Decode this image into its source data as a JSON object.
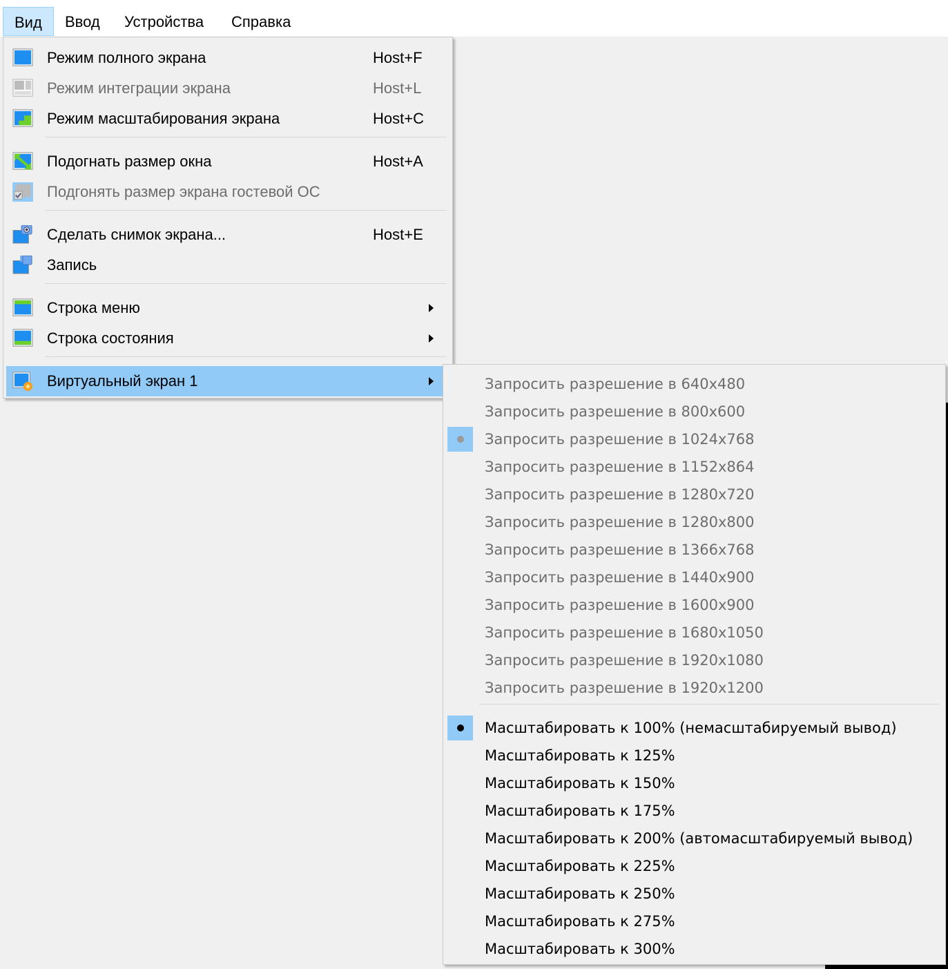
{
  "menubar": [
    "Вид",
    "Ввод",
    "Устройства",
    "Справка"
  ],
  "view_menu": {
    "items": [
      {
        "label": "Режим полного экрана",
        "shortcut": "Host+F",
        "icon": "fullscreen-icon",
        "disabled": false
      },
      {
        "label": "Режим интеграции экрана",
        "shortcut": "Host+L",
        "icon": "seamless-icon",
        "disabled": true
      },
      {
        "label": "Режим масштабирования экрана",
        "shortcut": "Host+C",
        "icon": "scale-mode-icon",
        "disabled": false
      },
      {
        "label": "Подогнать размер окна",
        "shortcut": "Host+A",
        "icon": "adjust-window-icon",
        "disabled": false
      },
      {
        "label": "Подгонять размер экрана гостевой ОС",
        "shortcut": "",
        "icon": "guest-autoresize-icon",
        "disabled": true
      },
      {
        "label": "Сделать снимок экрана...",
        "shortcut": "Host+E",
        "icon": "screenshot-icon",
        "disabled": false
      },
      {
        "label": "Запись",
        "shortcut": "",
        "icon": "recording-icon",
        "disabled": false
      },
      {
        "label": "Строка меню",
        "shortcut": "",
        "icon": "menu-bar-icon",
        "disabled": false
      },
      {
        "label": "Строка состояния",
        "shortcut": "",
        "icon": "status-bar-icon",
        "disabled": false
      },
      {
        "label": "Виртуальный экран 1",
        "shortcut": "",
        "icon": "virtual-screen-icon",
        "disabled": false
      }
    ]
  },
  "submenu": {
    "resolutions": [
      "Запросить разрешение в 640x480",
      "Запросить разрешение в 800x600",
      "Запросить разрешение в 1024x768",
      "Запросить разрешение в 1152x864",
      "Запросить разрешение в 1280x720",
      "Запросить разрешение в 1280x800",
      "Запросить разрешение в 1366x768",
      "Запросить разрешение в 1440x900",
      "Запросить разрешение в 1600x900",
      "Запросить разрешение в 1680x1050",
      "Запросить разрешение в 1920x1080",
      "Запросить разрешение в 1920x1200"
    ],
    "selected_resolution": 2,
    "scales": [
      "Масштабировать к 100% (немасштабируемый вывод)",
      "Масштабировать к 125%",
      "Масштабировать к 150%",
      "Масштабировать к 175%",
      "Масштабировать к 200% (автомасштабируемый вывод)",
      "Масштабировать к 225%",
      "Масштабировать к 250%",
      "Масштабировать к 275%",
      "Масштабировать к 300%"
    ],
    "selected_scale": 0
  }
}
